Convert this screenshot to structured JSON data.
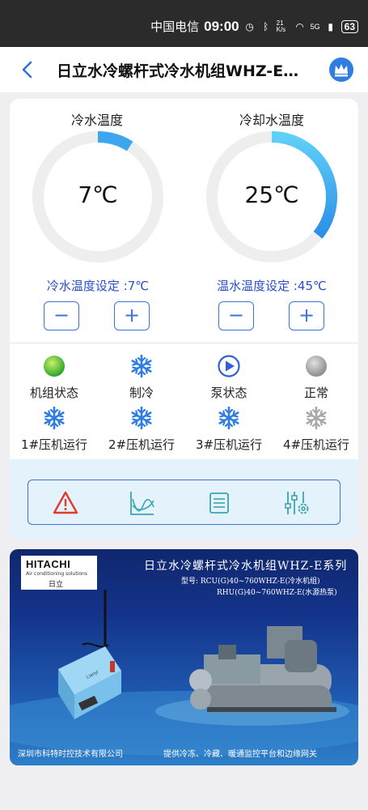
{
  "status_bar": {
    "carrier": "中国电信",
    "time": "09:00",
    "net_speed": "21 K/s",
    "network": "5G",
    "battery": "63"
  },
  "nav": {
    "title": "日立水冷螺杆式冷水机组WHZ-E系列"
  },
  "gauges": {
    "chilled": {
      "title": "冷水温度",
      "value": "7℃",
      "fraction": 0.09,
      "setpoint": "冷水温度设定 :7℃"
    },
    "cooling": {
      "title": "冷却水温度",
      "value": "25℃",
      "fraction": 0.36,
      "setpoint": "温水温度设定 :45℃"
    }
  },
  "buttons": {
    "minus": "−",
    "plus": "+"
  },
  "status_rows": [
    [
      {
        "label": "机组状态",
        "icon": "green-status-dot-icon"
      },
      {
        "label": "制冷",
        "icon": "snowflake-icon"
      },
      {
        "label": "泵状态",
        "icon": "play-circle-icon"
      },
      {
        "label": "正常",
        "icon": "gray-status-dot-icon"
      }
    ],
    [
      {
        "label": "1#压机运行",
        "icon": "snowflake-icon"
      },
      {
        "label": "2#压机运行",
        "icon": "snowflake-icon"
      },
      {
        "label": "3#压机运行",
        "icon": "snowflake-icon"
      },
      {
        "label": "4#压机运行",
        "icon": "snowflake-gray-icon"
      }
    ]
  ],
  "toolbar": [
    "alarm-icon",
    "trend-chart-icon",
    "list-icon",
    "settings-sliders-icon"
  ],
  "colors": {
    "accent": "#3f72d6",
    "gauge_track": "#eeeeee",
    "gauge_fill": "#3ca7f0",
    "banner_bg": "#14338a"
  },
  "banner": {
    "logo_brand": "HITACHI",
    "logo_sub": "Air conditioning solutions",
    "logo_cn": "日立",
    "title": "日立水冷螺杆式冷水机组WHZ-E系列",
    "model_line1": "型号: RCU(G)40~760WHZ-E(冷水机组)",
    "model_line2": "RHU(G)40~760WHZ-E(水源热泵)",
    "gateway_brand": "Lianyi",
    "footer_left": "深圳市科特时控技术有限公司",
    "footer_right": "提供冷冻、冷藏、暖通监控平台和边缘网关"
  }
}
